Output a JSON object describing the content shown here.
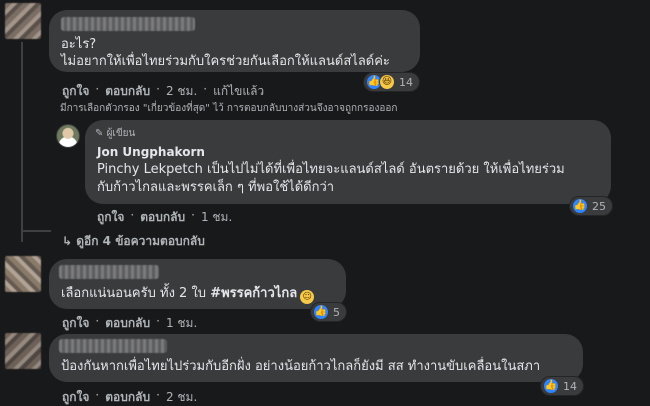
{
  "comments": [
    {
      "text_lines": [
        "อะไร?",
        "ไม่อยากให้เพื่อไทยร่วมกับใครช่วยกันเลือกให้แลนด์สไลด์ค่ะ"
      ],
      "actions": {
        "like": "ถูกใจ",
        "reply": "ตอบกลับ",
        "time": "2 ชม.",
        "edited": "แก้ไขแล้ว"
      },
      "reactions": {
        "icons": [
          "like-icon",
          "haha-icon"
        ],
        "count": "14"
      },
      "note": "มีการเลือกตัวกรอง \"เกี่ยวข้องที่สุด\" ไว้ การตอบกลับบางส่วนจึงอาจถูกกรองออก"
    },
    {
      "author_badge": "ผู้เขียน",
      "author_name": "Jon Ungphakorn",
      "text_lines": [
        "Pinchy Lekpetch เป็นไปไม่ได้ที่เพื่อไทยจะแลนด์สไลด์ อันตรายด้วย ให้เพื่อไทยร่วม",
        "กับก้าวไกลและพรรคเล็ก ๆ ที่พอใช้ได้ดีกว่า"
      ],
      "actions": {
        "like": "ถูกใจ",
        "reply": "ตอบกลับ",
        "time": "1 ชม."
      },
      "reactions": {
        "icons": [
          "like-icon"
        ],
        "count": "25"
      },
      "more_replies": "ดูอีก 4 ข้อความตอบกลับ"
    },
    {
      "text_prefix": "เลือกแน่นอนครับ ทั้ง 2 ใบ ",
      "hashtag": "#พรรคก้าวไกล",
      "actions": {
        "like": "ถูกใจ",
        "reply": "ตอบกลับ",
        "time": "1 ชม."
      },
      "reactions": {
        "icons": [
          "like-icon"
        ],
        "count": "5"
      }
    },
    {
      "text": "ป้องกันหากเพื่อไทยไปร่วมกับอีกฝั่ง อย่างน้อยก้าวไกลก็ยังมี สส ทำงานขับเคลื่อนในสภา",
      "actions": {
        "like": "ถูกใจ",
        "reply": "ตอบกลับ",
        "time": "2 ชม."
      },
      "reactions": {
        "icons": [
          "like-icon"
        ],
        "count": "14"
      }
    }
  ],
  "colors": {
    "background": "#18191a",
    "bubble": "#3a3b3c",
    "like": "#2d86ff",
    "haha": "#f7c948",
    "muted": "#b0b3b8"
  }
}
